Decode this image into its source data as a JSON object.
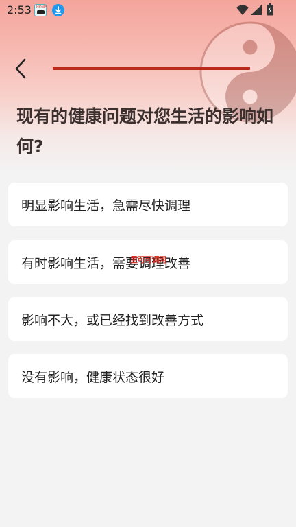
{
  "status_bar": {
    "time": "2:53",
    "icons": [
      "app-notification-icon",
      "download-icon",
      "wifi-icon",
      "signal-icon",
      "battery-icon"
    ]
  },
  "header": {
    "back_icon": "chevron-left-icon",
    "progress_fraction": 1.0,
    "progress_color": "#bb2a1a"
  },
  "question": {
    "title": "现有的健康问题对您生活的影响如何?"
  },
  "options": [
    {
      "label": "明显影响生活，急需尽快调理"
    },
    {
      "label": "有时影响生活，需要调理改善"
    },
    {
      "label": "影响不大，或已经找到改善方式"
    },
    {
      "label": "没有影响，健康状态很好"
    }
  ],
  "overlay": {
    "watermark_text": "里可可调网"
  },
  "colors": {
    "header_top": "#f4a59c",
    "background": "#f3f3f3",
    "title_text": "#3b302e",
    "card": "#ffffff"
  }
}
